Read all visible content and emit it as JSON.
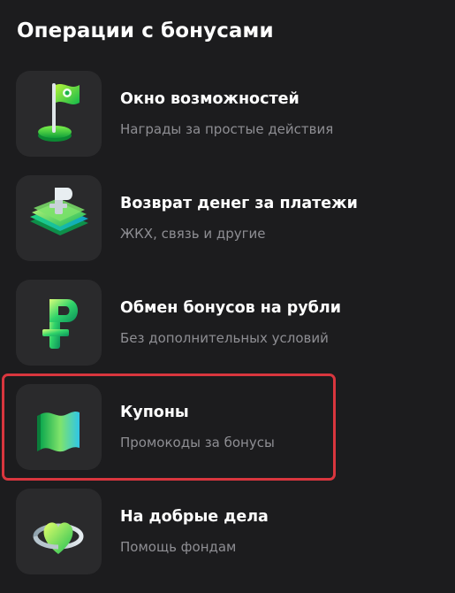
{
  "header": {
    "title": "Операции с бонусами"
  },
  "items": [
    {
      "title": "Окно возможностей",
      "subtitle": "Награды за простые действия",
      "icon": "green-flag-icon"
    },
    {
      "title": "Возврат денег за платежи",
      "subtitle": "ЖКХ, связь и другие",
      "icon": "ruble-cashback-icon"
    },
    {
      "title": "Обмен бонусов на рубли",
      "subtitle": "Без дополнительных условий",
      "icon": "ruble-sign-icon"
    },
    {
      "title": "Купоны",
      "subtitle": "Промокоды за бонусы",
      "icon": "coupon-flag-icon"
    },
    {
      "title": "На добрые дела",
      "subtitle": "Помощь фондам",
      "icon": "heart-ring-icon"
    }
  ],
  "colors": {
    "background": "#1c1c1e",
    "tile": "#2a2a2c",
    "subtitle": "#8e8e93",
    "highlight": "#d9363e",
    "accent_green": "#21d44a"
  }
}
